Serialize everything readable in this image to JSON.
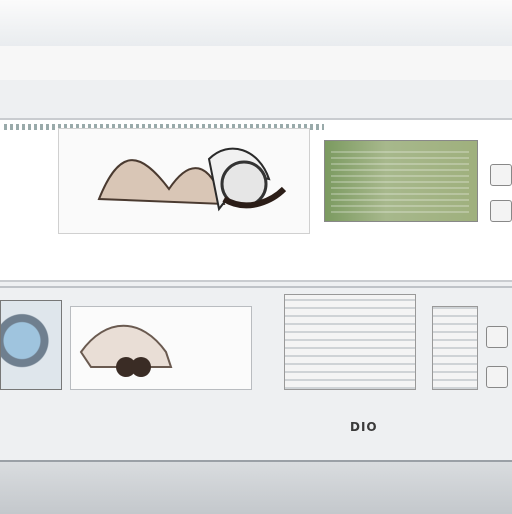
{
  "header": {
    "nav_text": "",
    "sub_text": ""
  },
  "title": {
    "text": ""
  },
  "utility": {
    "text": ""
  },
  "card1": {
    "caption": "",
    "meta": "",
    "meta_sub": "",
    "price": ""
  },
  "card2": {
    "price": "DIO"
  },
  "footer": {
    "text": ""
  },
  "colors": {
    "title": "#b6294d",
    "accent": "#4a2a36"
  },
  "icons": [
    "menu-icon",
    "gear-icon",
    "product-image",
    "settings-icon"
  ]
}
